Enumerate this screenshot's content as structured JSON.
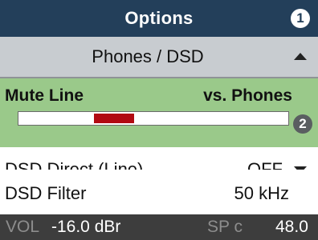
{
  "header": {
    "title": "Options",
    "badge": "1"
  },
  "submenu": {
    "label": "Phones / DSD",
    "arrow_icon": "triangle-up-icon"
  },
  "mute": {
    "left_label": "Mute Line",
    "right_label": "vs. Phones",
    "badge": "2",
    "level": {
      "start": 0.28,
      "end": 0.43
    },
    "level_color": "#b10a12"
  },
  "rows": [
    {
      "label": "DSD Direct (Line)",
      "value": "OFF",
      "arrow_icon": "triangle-down-icon"
    },
    {
      "label": "DSD Filter",
      "value": "50 kHz"
    }
  ],
  "status": {
    "vol_label": "VOL",
    "vol_value": "-16.0 dBr",
    "sp_label": "SP c",
    "sp_value": "48.0"
  },
  "colors": {
    "header_bg": "#233f5a",
    "submenu_bg": "#c8ccd0",
    "selected_bg": "#9ac98a",
    "status_bg": "#3d3d3d"
  }
}
